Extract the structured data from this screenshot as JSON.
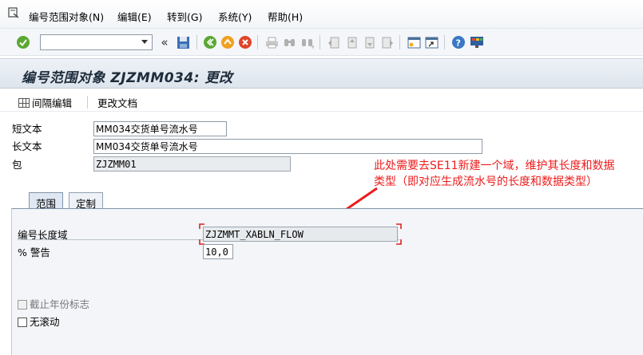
{
  "menubar": {
    "items": [
      "编号范围对象(N)",
      "编辑(E)",
      "转到(G)",
      "系统(Y)",
      "帮助(H)"
    ]
  },
  "toolbar": {
    "command_field_value": "",
    "icons": [
      "enter-icon",
      "command-dropdown-icon",
      "collapse-icon",
      "save-icon",
      "back-icon",
      "exit-icon",
      "cancel-icon",
      "print-icon",
      "find-icon",
      "find-next-icon",
      "first-page-icon",
      "previous-page-icon",
      "next-page-icon",
      "last-page-icon",
      "create-session-icon",
      "shortcut-icon",
      "help-icon",
      "customize-layout-icon"
    ]
  },
  "title": "编号范围对象 ZJZMM034: 更改",
  "app_toolbar": {
    "interval_edit_label": "间隔编辑",
    "change_docs_label": "更改文档"
  },
  "form": {
    "short_text_label": "短文本",
    "short_text_value": "MM034交货单号流水号",
    "long_text_label": "长文本",
    "long_text_value": "MM034交货单号流水号",
    "package_label": "包",
    "package_value": "ZJZMM01"
  },
  "annotation": {
    "line1": "此处需要去SE11新建一个域，维护其长度和数据",
    "line2": "类型（即对应生成流水号的长度和数据类型）",
    "color": "#ee1c1c"
  },
  "tabs": [
    {
      "label": "范围",
      "active": true
    },
    {
      "label": "定制",
      "active": false
    }
  ],
  "range_tab": {
    "number_length_domain_label": "编号长度域",
    "number_length_domain_value": "ZJZMMT_XABLN_FLOW",
    "warning_label": "% 警告",
    "warning_value": "10,0",
    "to_fiscal_year_label": "截止年份标志",
    "to_fiscal_year_checked": false,
    "no_rolling_label": "无滚动",
    "no_rolling_checked": false
  }
}
